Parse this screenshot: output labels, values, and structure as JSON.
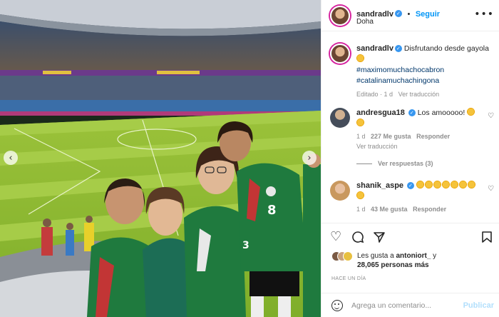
{
  "header": {
    "username": "sandradlv",
    "follow_label": "Seguir",
    "location": "Doha",
    "more": "•••"
  },
  "caption": {
    "username": "sandradlv",
    "text": "Disfrutando desde gayola",
    "hashtag1": "#maximomuchachocabron",
    "hashtag2": "#catalinamuchachingona",
    "meta_edited": "Editado",
    "meta_time": "1 d",
    "translate": "Ver traducción"
  },
  "comments": [
    {
      "username": "andresgua18",
      "text": "Los amooooo!",
      "time": "1 d",
      "likes": "227 Me gusta",
      "reply": "Responder",
      "translate": "Ver traducción",
      "view_replies": "Ver respuestas (3)"
    },
    {
      "username": "shanik_aspe",
      "time": "1 d",
      "likes": "43 Me gusta",
      "reply": "Responder"
    }
  ],
  "likes": {
    "prefix": "Les gusta a",
    "user": "antoniort_",
    "conj": "y",
    "rest": "28,065 personas más"
  },
  "timestamp": "HACE UN DÍA",
  "add_comment": {
    "placeholder": "Agrega un comentario...",
    "publish": "Publicar"
  },
  "icons": {
    "heart": "heart-icon",
    "comment": "comment-icon",
    "share": "share-icon",
    "save": "bookmark-icon",
    "emoji": "emoji-icon"
  },
  "colors": {
    "accent": "#0095f6",
    "hashtag": "#00376b",
    "verified": "#3897f0",
    "muted": "#8e8e8e"
  }
}
